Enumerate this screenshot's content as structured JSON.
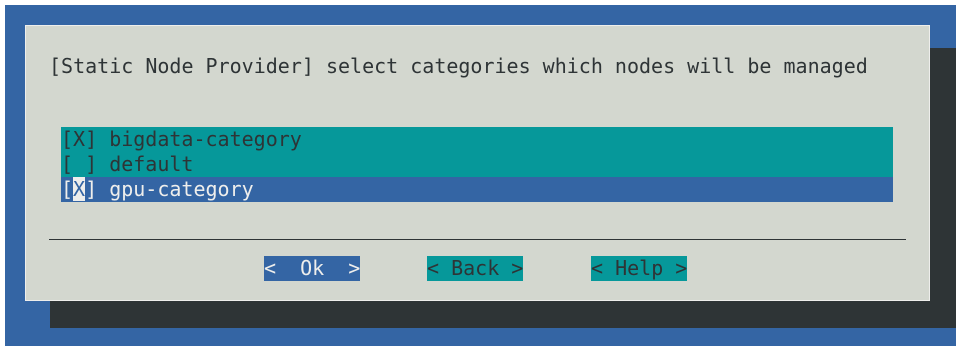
{
  "dialog": {
    "title": "[Static Node Provider] select categories which nodes will be managed"
  },
  "checklist": {
    "items": [
      {
        "mark_open": "[",
        "mark_value": "X",
        "mark_close": "]",
        "label": "bigdata-category",
        "checked": true
      },
      {
        "mark_open": "[",
        "mark_value": " ",
        "mark_close": "]",
        "label": "default",
        "checked": false
      },
      {
        "mark_open": "[",
        "mark_value": "X",
        "mark_close": "]",
        "label": "gpu-category",
        "checked": true
      }
    ]
  },
  "buttons": {
    "ok": "<  Ok  >",
    "back": "< Back >",
    "help": "< Help >"
  },
  "colors": {
    "terminal_bg": "#3465a4",
    "dialog_bg": "#d3d7cf",
    "item_bg": "#06989a",
    "selected_bg": "#3465a4",
    "shadow": "#2e3436"
  }
}
